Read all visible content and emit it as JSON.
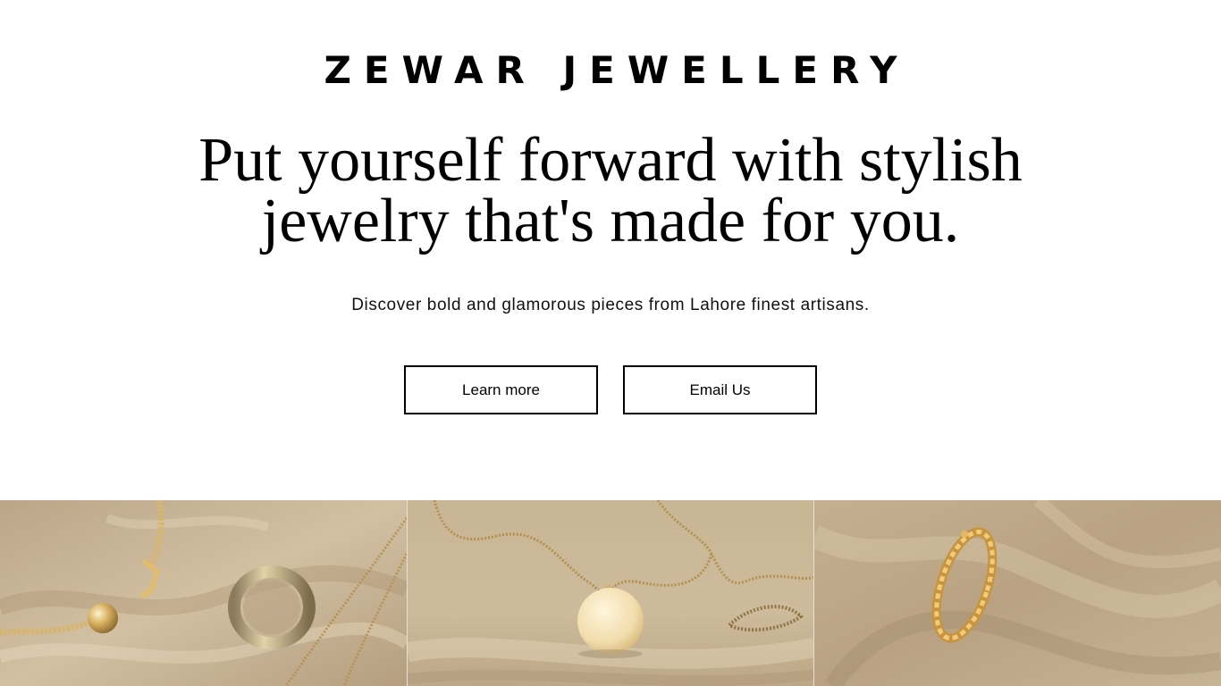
{
  "brand": {
    "name": "ZEWAR JEWELLERY"
  },
  "hero": {
    "headline_line1": "Put yourself forward with stylish",
    "headline_line2": "jewelry that's made for you.",
    "subtitle": "Discover bold and glamorous pieces from Lahore finest artisans."
  },
  "buttons": {
    "learn_more": "Learn more",
    "email_us": "Email Us"
  },
  "gallery": {
    "images": [
      {
        "name": "bracelet-and-ring-photo"
      },
      {
        "name": "pendant-necklace-photo"
      },
      {
        "name": "chain-ring-photo"
      }
    ]
  },
  "colors": {
    "background": "#ffffff",
    "text": "#000000",
    "fabric": "#c9b595",
    "gold": "#d9b56a"
  }
}
